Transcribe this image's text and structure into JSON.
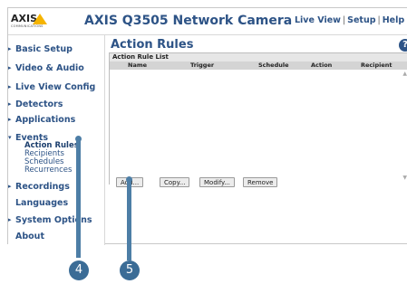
{
  "header": {
    "logo_text": "AXIS",
    "logo_sub": "COMMUNICATIONS",
    "product_title": "AXIS Q3505 Network Camera",
    "links": [
      {
        "label": "Live View"
      },
      {
        "label": "Setup"
      },
      {
        "label": "Help"
      }
    ],
    "separator": "|"
  },
  "sidebar": {
    "items": [
      {
        "label": "Basic Setup"
      },
      {
        "label": "Video & Audio"
      },
      {
        "label": "Live View Config"
      },
      {
        "label": "Detectors"
      },
      {
        "label": "Applications"
      },
      {
        "label": "Events",
        "expanded": true,
        "children": [
          {
            "label": "Action Rules",
            "active": true
          },
          {
            "label": "Recipients"
          },
          {
            "label": "Schedules"
          },
          {
            "label": "Recurrences"
          }
        ]
      },
      {
        "label": "Recordings"
      },
      {
        "label": "Languages"
      },
      {
        "label": "System Options"
      },
      {
        "label": "About"
      }
    ],
    "arrow_glyph": "▸",
    "expanded_glyph": "▾"
  },
  "main": {
    "title": "Action Rules",
    "help_icon": "?",
    "list": {
      "caption": "Action Rule List",
      "columns": [
        "Name",
        "Trigger",
        "Schedule",
        "Action",
        "Recipient"
      ],
      "rows": []
    },
    "buttons": [
      {
        "label": "Add..."
      },
      {
        "label": "Copy..."
      },
      {
        "label": "Modify..."
      },
      {
        "label": "Remove"
      }
    ]
  },
  "callouts": [
    {
      "number": "4"
    },
    {
      "number": "5"
    }
  ],
  "colors": {
    "nav_blue": "#2d5386",
    "callout_blue": "#3b6c96",
    "logo_yellow": "#f5b400"
  }
}
